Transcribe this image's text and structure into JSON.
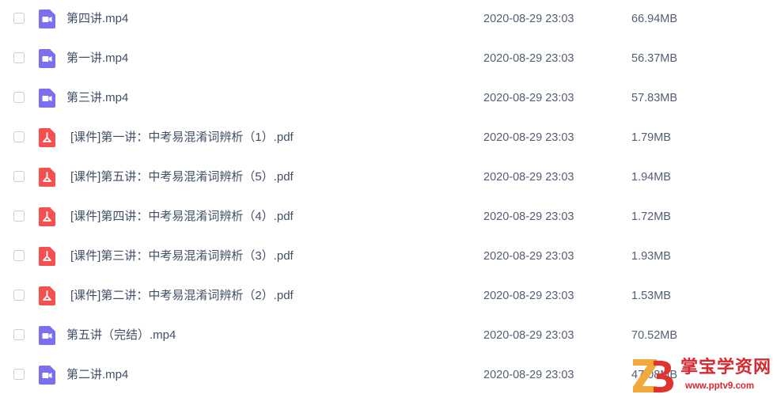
{
  "files": [
    {
      "name": "第四讲.mp4",
      "type": "video",
      "date": "2020-08-29 23:03",
      "size": "66.94MB"
    },
    {
      "name": "第一讲.mp4",
      "type": "video",
      "date": "2020-08-29 23:03",
      "size": "56.37MB"
    },
    {
      "name": "第三讲.mp4",
      "type": "video",
      "date": "2020-08-29 23:03",
      "size": "57.83MB"
    },
    {
      "name": "[课件]第一讲：中考易混淆词辨析（1）.pdf",
      "type": "pdf",
      "date": "2020-08-29 23:03",
      "size": "1.79MB"
    },
    {
      "name": "[课件]第五讲：中考易混淆词辨析（5）.pdf",
      "type": "pdf",
      "date": "2020-08-29 23:03",
      "size": "1.94MB"
    },
    {
      "name": "[课件]第四讲：中考易混淆词辨析（4）.pdf",
      "type": "pdf",
      "date": "2020-08-29 23:03",
      "size": "1.72MB"
    },
    {
      "name": "[课件]第三讲：中考易混淆词辨析（3）.pdf",
      "type": "pdf",
      "date": "2020-08-29 23:03",
      "size": "1.93MB"
    },
    {
      "name": "[课件]第二讲：中考易混淆词辨析（2）.pdf",
      "type": "pdf",
      "date": "2020-08-29 23:03",
      "size": "1.53MB"
    },
    {
      "name": "第五讲（完结）.mp4",
      "type": "video",
      "date": "2020-08-29 23:03",
      "size": "70.52MB"
    },
    {
      "name": "第二讲.mp4",
      "type": "video",
      "date": "2020-08-29 23:03",
      "size": "47.08MB"
    }
  ],
  "icons": {
    "video": "video-file-icon",
    "pdf": "pdf-file-icon"
  },
  "colors": {
    "video_icon": "#7b6ff0",
    "pdf_icon": "#f5504f",
    "watermark": "#d9282f",
    "text": "#424e67",
    "meta_text": "#535d73"
  },
  "watermark": {
    "title": "掌宝学资网",
    "url": "www.pptv9.com"
  }
}
